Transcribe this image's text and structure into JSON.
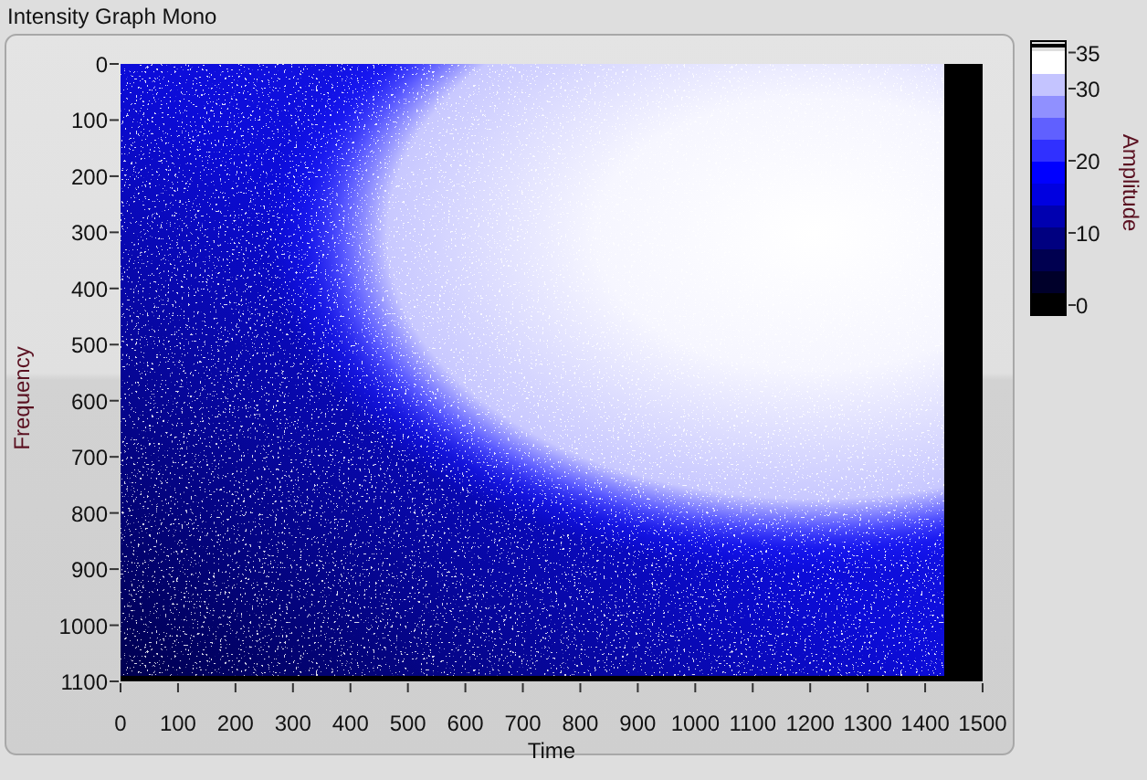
{
  "title": "Intensity Graph Mono",
  "graph": {
    "y_axis": {
      "label": "Frequency",
      "ticks": [
        "0",
        "100",
        "200",
        "300",
        "400",
        "500",
        "600",
        "700",
        "800",
        "900",
        "1000",
        "1100"
      ]
    },
    "x_axis": {
      "label": "Time",
      "ticks": [
        "0",
        "100",
        "200",
        "300",
        "400",
        "500",
        "600",
        "700",
        "800",
        "900",
        "1000",
        "1100",
        "1200",
        "1300",
        "1400",
        "1500"
      ]
    }
  },
  "color_scale": {
    "label": "Amplitude",
    "ticks": [
      "35",
      "30",
      "20",
      "10",
      "0"
    ]
  }
}
